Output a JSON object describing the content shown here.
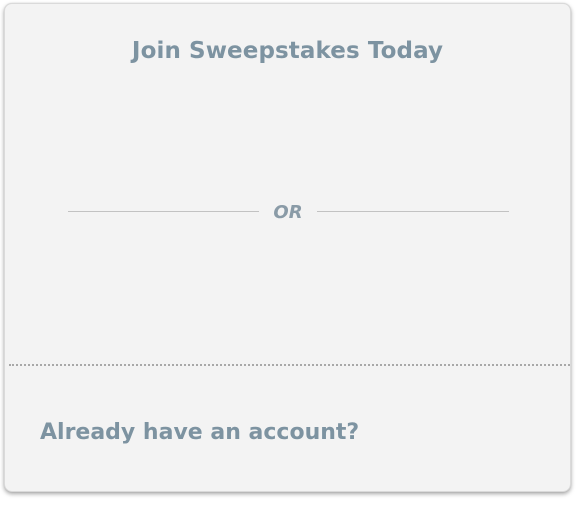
{
  "card": {
    "title": "Join Sweepstakes Today",
    "separator_text": "OR",
    "footer_link": "Already have an account?"
  },
  "colors": {
    "card_background": "#f3f3f3",
    "heading_text": "#7d93a1",
    "separator_text": "#8a9ba7",
    "separator_line": "#c2c2c2",
    "dotted_divider": "#a8a8a8"
  }
}
